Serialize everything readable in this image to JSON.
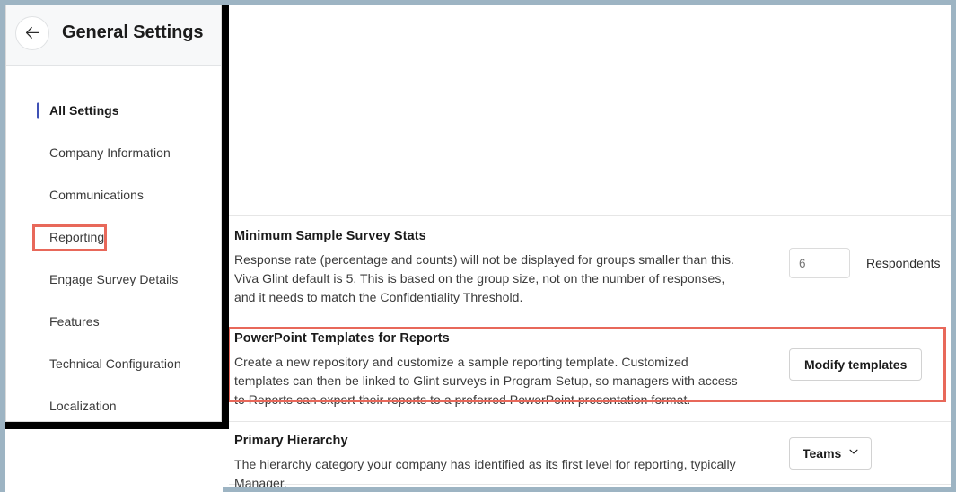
{
  "window": {
    "frame_color": "#9db4c3",
    "callout_border_color": "#000000",
    "annotation_color": "#e8685a",
    "accent_color": "#3f51b5"
  },
  "sidebar": {
    "back_button_icon": "arrow-left-icon",
    "title": "General Settings",
    "items": [
      {
        "label": "All Settings",
        "active": true
      },
      {
        "label": "Company Information",
        "active": false
      },
      {
        "label": "Communications",
        "active": false
      },
      {
        "label": "Reporting",
        "active": false,
        "highlighted": true
      },
      {
        "label": "Engage Survey Details",
        "active": false
      },
      {
        "label": "Features",
        "active": false
      },
      {
        "label": "Technical Configuration",
        "active": false
      },
      {
        "label": "Localization",
        "active": false
      }
    ]
  },
  "main": {
    "settings": [
      {
        "id": "minimum-sample-survey-stats",
        "title": "Minimum Sample Survey Stats",
        "description": "Response rate (percentage and counts) will not be displayed for groups smaller than this. Viva Glint default is 5. This is based on the group size, not on the number of responses, and it needs to match the Confidentiality Threshold.",
        "control": {
          "type": "number-input",
          "value": "6",
          "placeholder": "6",
          "suffix_label": "Respondents"
        }
      },
      {
        "id": "powerpoint-templates-for-reports",
        "title": "PowerPoint Templates for Reports",
        "description": "Create a new repository and customize a sample reporting template. Customized templates can then be linked to Glint surveys in Program Setup, so managers with access to Reports can export their reports to a preferred PowerPoint presentation format.",
        "highlighted": true,
        "control": {
          "type": "button",
          "label": "Modify templates"
        }
      },
      {
        "id": "primary-hierarchy",
        "title": "Primary Hierarchy",
        "description": "The hierarchy category your company has identified as its first level for reporting, typically Manager.",
        "control": {
          "type": "dropdown",
          "label": "Teams",
          "icon": "chevron-down-icon"
        }
      }
    ]
  }
}
